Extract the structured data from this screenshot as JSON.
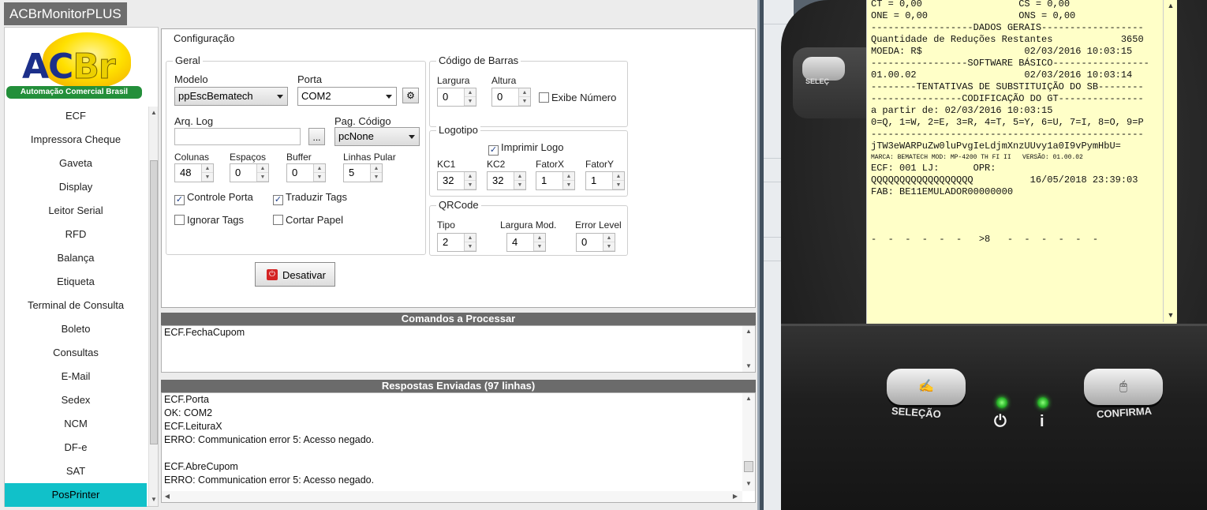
{
  "window": {
    "title": "ACBrMonitorPLUS"
  },
  "logo": {
    "text_ac": "AC",
    "text_br": "Br",
    "tagline": "Automação Comercial Brasil"
  },
  "sidebar": {
    "items": [
      {
        "label": "ECF"
      },
      {
        "label": "Impressora Cheque"
      },
      {
        "label": "Gaveta"
      },
      {
        "label": "Display"
      },
      {
        "label": "Leitor Serial"
      },
      {
        "label": "RFD"
      },
      {
        "label": "Balança"
      },
      {
        "label": "Etiqueta"
      },
      {
        "label": "Terminal de Consulta"
      },
      {
        "label": "Boleto"
      },
      {
        "label": "Consultas"
      },
      {
        "label": "E-Mail"
      },
      {
        "label": "Sedex"
      },
      {
        "label": "NCM"
      },
      {
        "label": "DF-e"
      },
      {
        "label": "SAT"
      },
      {
        "label": "PosPrinter"
      }
    ],
    "selected": "PosPrinter"
  },
  "config": {
    "legend": "Configuração",
    "geral": {
      "legend": "Geral",
      "modelo_label": "Modelo",
      "modelo_value": "ppEscBematech",
      "porta_label": "Porta",
      "porta_value": "COM2",
      "arq_log_label": "Arq. Log",
      "arq_log_value": "",
      "browse_label": "...",
      "pag_codigo_label": "Pag. Código",
      "pag_codigo_value": "pcNone",
      "colunas_label": "Colunas",
      "colunas_value": "48",
      "espacos_label": "Espaços",
      "espacos_value": "0",
      "buffer_label": "Buffer",
      "buffer_value": "0",
      "linhas_pular_label": "Linhas Pular",
      "linhas_pular_value": "5",
      "controle_porta_label": "Controle Porta",
      "controle_porta_checked": true,
      "traduzir_tags_label": "Traduzir Tags",
      "traduzir_tags_checked": true,
      "ignorar_tags_label": "Ignorar Tags",
      "ignorar_tags_checked": false,
      "cortar_papel_label": "Cortar Papel",
      "cortar_papel_checked": false
    },
    "codigo_barras": {
      "legend": "Código de Barras",
      "largura_label": "Largura",
      "largura_value": "0",
      "altura_label": "Altura",
      "altura_value": "0",
      "exibe_numero_label": "Exibe Número",
      "exibe_numero_checked": false
    },
    "logotipo": {
      "legend": "Logotipo",
      "imprimir_logo_label": "Imprimir Logo",
      "imprimir_logo_checked": true,
      "kc1_label": "KC1",
      "kc1_value": "32",
      "kc2_label": "KC2",
      "kc2_value": "32",
      "fatorx_label": "FatorX",
      "fatorx_value": "1",
      "fatory_label": "FatorY",
      "fatory_value": "1"
    },
    "qrcode": {
      "legend": "QRCode",
      "tipo_label": "Tipo",
      "tipo_value": "2",
      "largura_mod_label": "Largura Mod.",
      "largura_mod_value": "4",
      "error_level_label": "Error Level",
      "error_level_value": "0"
    },
    "desativar_label": "Desativar"
  },
  "commands": {
    "header": "Comandos a Processar",
    "lines": [
      "ECF.FechaCupom"
    ]
  },
  "responses": {
    "header": "Respostas Enviadas (97 linhas)",
    "lines": [
      "ECF.Porta",
      "OK: COM2",
      "ECF.LeituraX",
      "ERRO: Communication error 5: Acesso negado.",
      "",
      "ECF.AbreCupom",
      "ERRO: Communication error 5: Acesso negado."
    ]
  },
  "printer": {
    "paper_lines": [
      "CT = 0,00                 CS = 0,00",
      "ONE = 0,00                ONS = 0,00",
      "------------------DADOS GERAIS------------------",
      "Quantidade de Reduções Restantes            3650",
      "MOEDA: R$                  02/03/2016 10:03:15",
      "-----------------SOFTWARE BÁSICO-----------------",
      "01.00.02                   02/03/2016 10:03:14",
      "--------TENTATIVAS DE SUBSTITUIÇÃO DO SB--------",
      "----------------CODIFICAÇÃO DO GT---------------",
      "a partir de: 02/03/2016 10:03:15",
      "0=Q, 1=W, 2=E, 3=R, 4=T, 5=Y, 6=U, 7=I, 8=O, 9=P",
      "------------------------------------------------",
      "jTW3eWARPuZw0luPvgIeLdjmXnzUUvy1a0I9vPymHbU=",
      "MARCA: BEMATECH MOD: MP-4200 TH FI II   VERSÃO: 01.00.02",
      "ECF: 001 LJ:      OPR:",
      "QQQQQQQQQQQQQQQQQQ          16/05/2018 23:39:03",
      "FAB: BE11EMULADOR00000000",
      "",
      "",
      "",
      "-  -  -  -  -  -   >8   -  -  -  -  -  -"
    ],
    "back_button_label": "SELEÇ",
    "selecao_label": "SELEÇÃO",
    "confirma_label": "CONFIRMA",
    "power_icon": "⏻",
    "info_icon": "i"
  }
}
